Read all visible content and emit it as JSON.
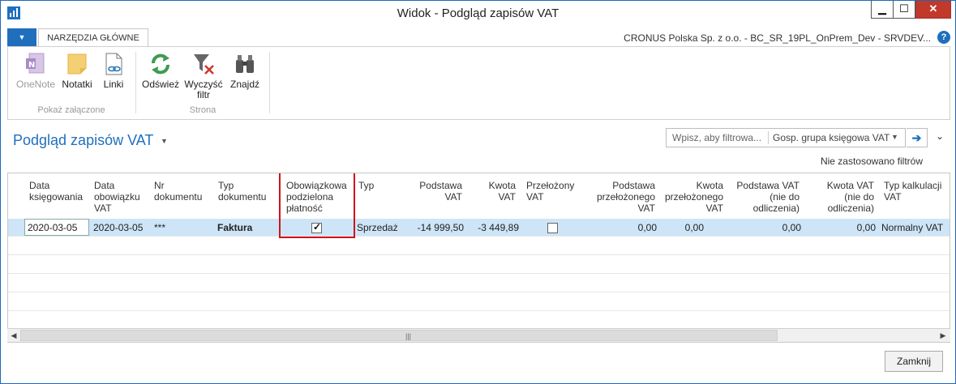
{
  "window": {
    "title": "Widok - Podgląd zapisów VAT",
    "min": "▁",
    "max": "☐",
    "close": "✕"
  },
  "ribbon": {
    "tab": "NARZĘDZIA GŁÓWNE",
    "company": "CRONUS Polska Sp. z o.o. - BC_SR_19PL_OnPrem_Dev - SRVDEV...",
    "help": "?",
    "buttons": {
      "onenote": "OneNote",
      "notes": "Notatki",
      "links": "Linki",
      "refresh": "Odśwież",
      "clear_filter_1": "Wyczyść",
      "clear_filter_2": "filtr",
      "find": "Znajdź"
    },
    "groups": {
      "attachments": "Pokaż załączone",
      "page": "Strona"
    }
  },
  "page": {
    "title": "Podgląd zapisów VAT",
    "filter_placeholder": "Wpisz, aby filtrowa...",
    "filter_field": "Gosp. grupa księgowa VAT",
    "no_filters": "Nie zastosowano filtrów"
  },
  "grid": {
    "headers": {
      "posting_date": [
        "Data",
        "księgowania"
      ],
      "vat_date": [
        "Data",
        "obowiązku",
        "VAT"
      ],
      "doc_no": [
        "Nr",
        "dokumentu"
      ],
      "doc_type": [
        "Typ",
        "dokumentu"
      ],
      "split_payment": [
        "Obowiązkowa",
        "podzielona",
        "płatność"
      ],
      "type": [
        "Typ"
      ],
      "base": [
        "Podstawa",
        "VAT"
      ],
      "amount": [
        "Kwota",
        "VAT"
      ],
      "reversed": [
        "Przełożony",
        "VAT"
      ],
      "reversed_base": [
        "Podstawa",
        "przełożonego",
        "VAT"
      ],
      "reversed_amount": [
        "Kwota",
        "przełożonego",
        "VAT"
      ],
      "nd_base": [
        "Podstawa VAT",
        "(nie do",
        "odliczenia)"
      ],
      "nd_amount": [
        "Kwota VAT",
        "(nie do",
        "odliczenia)"
      ],
      "calc_type": [
        "Typ kalkulacji",
        "VAT"
      ]
    },
    "rows": [
      {
        "posting_date": "2020-03-05",
        "vat_date": "2020-03-05",
        "doc_no": "***",
        "doc_type": "Faktura",
        "split_payment": true,
        "type": "Sprzedaż",
        "base": "-14 999,50",
        "amount": "-3 449,89",
        "reversed": false,
        "reversed_base": "0,00",
        "reversed_amount": "0,00",
        "nd_base": "0,00",
        "nd_amount": "0,00",
        "calc_type": "Normalny VAT"
      }
    ]
  },
  "footer": {
    "close": "Zamknij"
  }
}
